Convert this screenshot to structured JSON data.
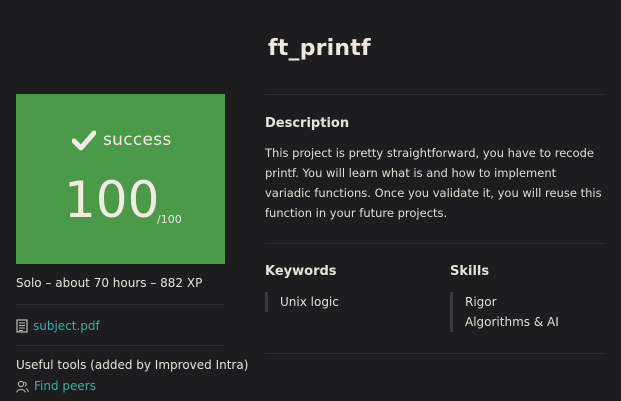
{
  "project": {
    "title": "ft_printf"
  },
  "result": {
    "status": "success",
    "score": "100",
    "max_score": "/100",
    "status_color": "#4a9a4a",
    "status_icon": "check-icon"
  },
  "meta": {
    "summary": "Solo – about 70 hours – 882 XP"
  },
  "attachments": [
    {
      "label": "subject.pdf",
      "icon": "document-icon"
    }
  ],
  "tools": {
    "heading": "Useful tools (added by Improved Intra)",
    "find_peers": {
      "label": "Find peers",
      "icon": "users-icon"
    }
  },
  "description": {
    "heading": "Description",
    "text": "This project is pretty straightforward, you have to recode printf. You will learn what is and how to implement variadic functions. Once you validate it, you will reuse this function in your future projects."
  },
  "keywords": {
    "heading": "Keywords",
    "items": [
      "Unix logic"
    ]
  },
  "skills": {
    "heading": "Skills",
    "items": [
      "Rigor",
      "Algorithms & AI"
    ]
  },
  "colors": {
    "background": "#1d1d20",
    "accent_link": "#37b1a4",
    "text": "#e6e3dc"
  }
}
